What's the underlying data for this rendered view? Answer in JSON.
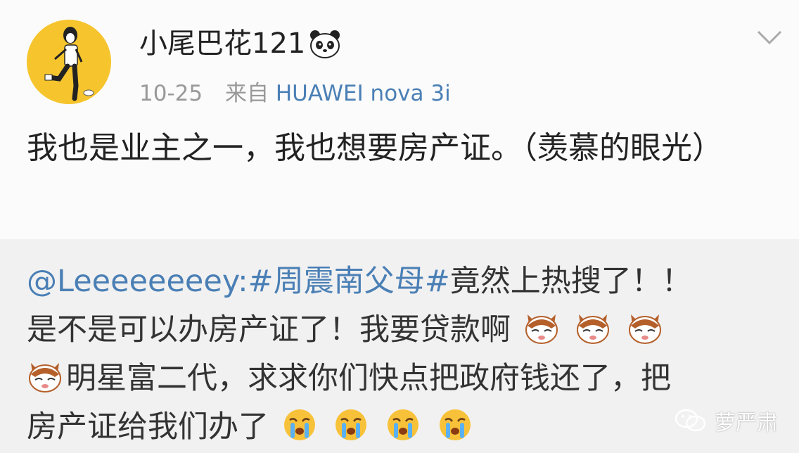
{
  "post": {
    "username": "小尾巴花121",
    "username_emoji_icon": "panda-icon",
    "date": "10-25",
    "source_prefix": "来自",
    "device": "HUAWEI nova 3i",
    "text": "我也是业主之一，我也想要房产证。（羡慕的眼光）",
    "menu_icon": "chevron-down-icon"
  },
  "repost": {
    "mention": "@Leeeeeeeey",
    "colon": ":",
    "hashtag": "#周震南父母#",
    "line1_rest": "竟然上热搜了！！",
    "line2": "是不是可以办房产证了！我要贷款啊",
    "line3": "明星富二代，求求你们快点把政府钱还了，把",
    "line4": "房产证给我们办了",
    "emojis_sad_icon": "crying-cat-icon",
    "emojis_cry_icon": "sobbing-face-icon"
  },
  "watermark": {
    "text": "萝严肃",
    "icon": "wechat-icon"
  },
  "colors": {
    "link": "#4a7fb5",
    "avatar_bg": "#f6c52e",
    "meta": "#999999"
  }
}
